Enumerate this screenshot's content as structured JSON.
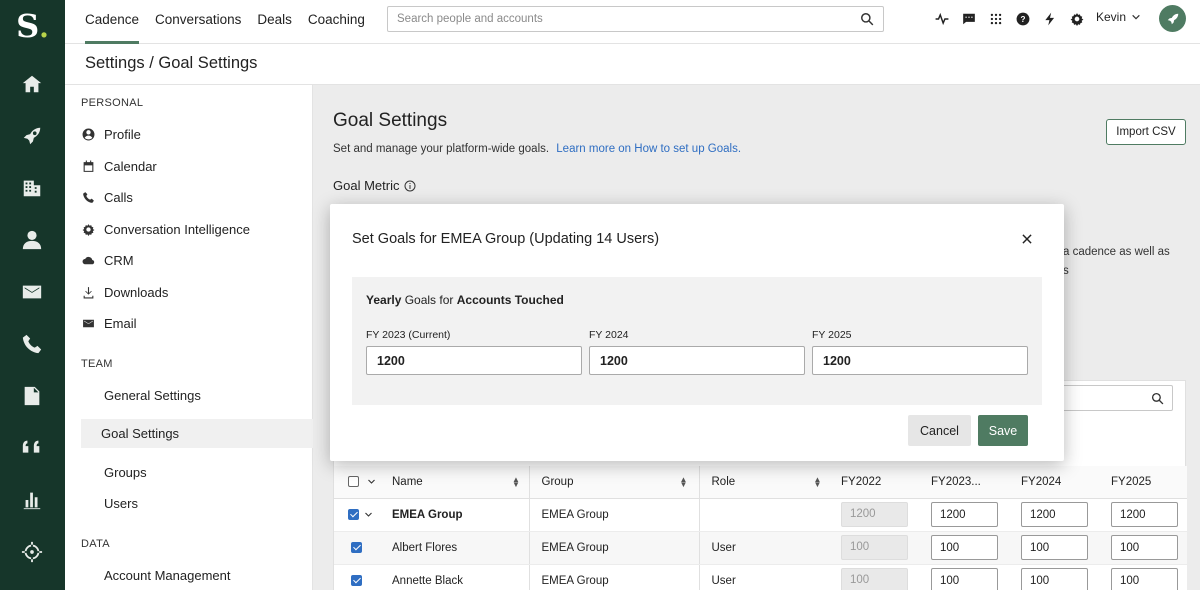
{
  "app": {
    "logo_letter": "S",
    "logo_dot": "."
  },
  "nav": {
    "tabs": [
      {
        "label": "Cadence"
      },
      {
        "label": "Conversations"
      },
      {
        "label": "Deals"
      },
      {
        "label": "Coaching"
      }
    ]
  },
  "search": {
    "placeholder": "Search people and accounts"
  },
  "user": {
    "name": "Kevin"
  },
  "breadcrumb": "Settings / Goal Settings",
  "sidebar": {
    "personal_label": "PERSONAL",
    "personal": [
      {
        "label": "Profile",
        "icon": "profile-icon"
      },
      {
        "label": "Calendar",
        "icon": "calendar-icon"
      },
      {
        "label": "Calls",
        "icon": "phone-icon"
      },
      {
        "label": "Conversation Intelligence",
        "icon": "gear-icon"
      },
      {
        "label": "CRM",
        "icon": "cloud-icon"
      },
      {
        "label": "Downloads",
        "icon": "download-icon"
      },
      {
        "label": "Email",
        "icon": "mail-icon"
      }
    ],
    "team_label": "TEAM",
    "team": [
      {
        "label": "General Settings"
      },
      {
        "label": "Goal Settings"
      },
      {
        "label": "Groups"
      },
      {
        "label": "Users"
      }
    ],
    "data_label": "DATA",
    "data": [
      {
        "label": "Account Management"
      }
    ]
  },
  "page": {
    "title": "Goal Settings",
    "description": "Set and manage your platform-wide goals.",
    "link": "Learn more on How to set up Goals.",
    "metric_label": "Goal Metric",
    "import_label": "Import CSV",
    "partial_text_1": "a cadence as well as",
    "partial_text_2": "s"
  },
  "table": {
    "headers": [
      "Name",
      "Group",
      "Role",
      "FY2022",
      "FY2023...",
      "FY2024",
      "FY2025"
    ],
    "rows": [
      {
        "name": "EMEA Group",
        "group": "EMEA Group",
        "role": "",
        "fy2022": "1200",
        "fy2023": "1200",
        "fy2024": "1200",
        "fy2025": "1200"
      },
      {
        "name": "Albert Flores",
        "group": "EMEA Group",
        "role": "User",
        "fy2022": "100",
        "fy2023": "100",
        "fy2024": "100",
        "fy2025": "100"
      },
      {
        "name": "Annette Black",
        "group": "EMEA Group",
        "role": "User",
        "fy2022": "100",
        "fy2023": "100",
        "fy2024": "100",
        "fy2025": "100"
      }
    ]
  },
  "modal": {
    "title": "Set Goals for EMEA Group (Updating 14 Users)",
    "panel_prefix": "Yearly",
    "panel_middle": " Goals for ",
    "panel_metric": "Accounts Touched",
    "fields": [
      {
        "label": "FY 2023 (Current)",
        "value": "1200"
      },
      {
        "label": "FY 2024",
        "value": "1200"
      },
      {
        "label": "FY 2025",
        "value": "1200"
      }
    ],
    "cancel_label": "Cancel",
    "save_label": "Save"
  },
  "colors": {
    "rail": "#16362a",
    "accent": "#4f7b62",
    "link": "#2f6ec2"
  }
}
